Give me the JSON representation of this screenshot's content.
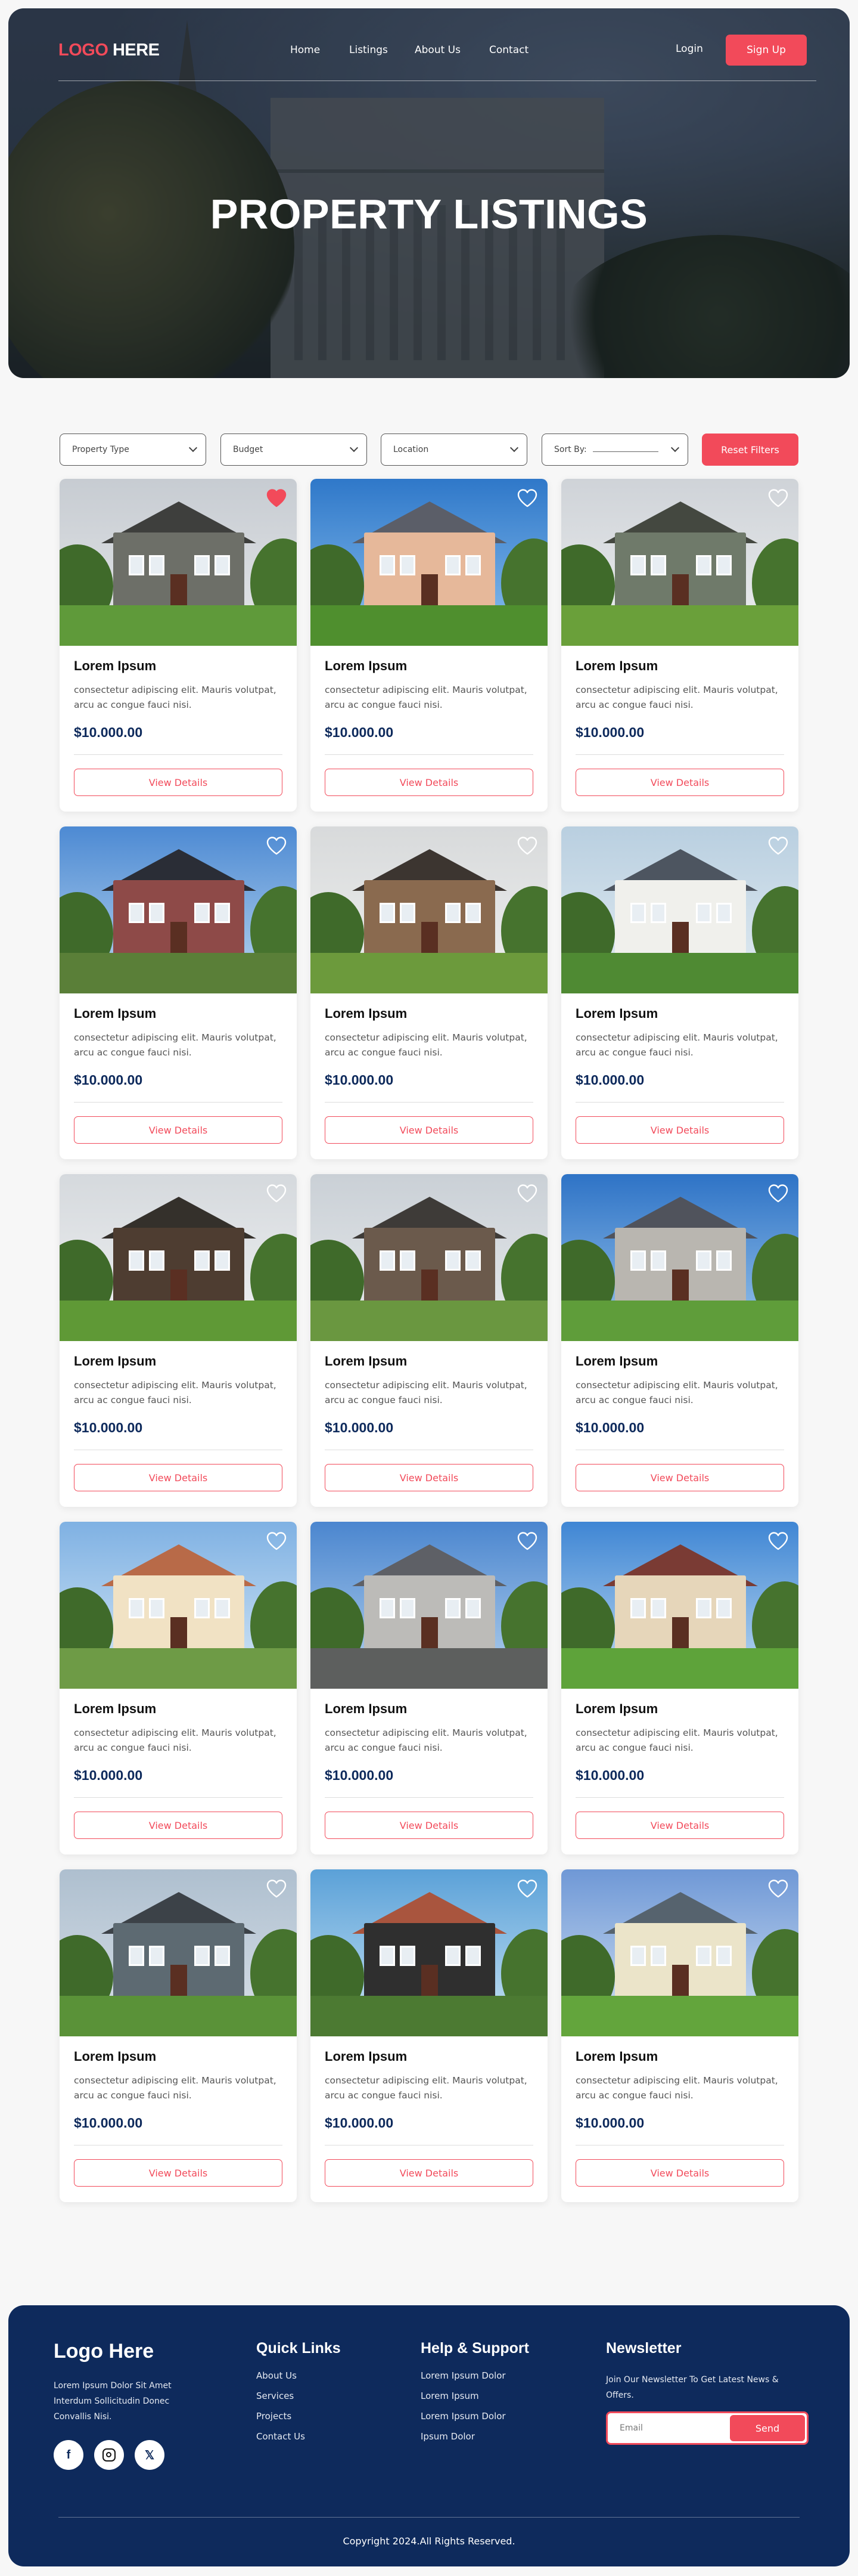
{
  "header": {
    "logo_part1": "LOGO",
    "logo_part2": "HERE",
    "nav": [
      {
        "label": "Home"
      },
      {
        "label": "Listings"
      },
      {
        "label": "About Us"
      },
      {
        "label": "Contact"
      }
    ],
    "login": "Login",
    "signup": "Sign Up"
  },
  "hero": {
    "title": "PROPERTY LISTINGS"
  },
  "filters": {
    "property_type": "Property Type",
    "budget": "Budget",
    "location": "Location",
    "sort_by": "Sort By:",
    "reset": "Reset Filters"
  },
  "listings": [
    {
      "title": "Lorem Ipsum",
      "desc": "consectetur adipiscing elit. Mauris volutpat, arcu ac congue fauci nisi.",
      "price": "$10.000.00",
      "cta": "View Details",
      "favorited": true
    },
    {
      "title": "Lorem Ipsum",
      "desc": "consectetur adipiscing elit. Mauris volutpat, arcu ac congue fauci nisi.",
      "price": "$10.000.00",
      "cta": "View Details",
      "favorited": false
    },
    {
      "title": "Lorem Ipsum",
      "desc": "consectetur adipiscing elit. Mauris volutpat, arcu ac congue fauci nisi.",
      "price": "$10.000.00",
      "cta": "View Details",
      "favorited": false
    },
    {
      "title": "Lorem Ipsum",
      "desc": "consectetur adipiscing elit. Mauris volutpat, arcu ac congue fauci nisi.",
      "price": "$10.000.00",
      "cta": "View Details",
      "favorited": false
    },
    {
      "title": "Lorem Ipsum",
      "desc": "consectetur adipiscing elit. Mauris volutpat, arcu ac congue fauci nisi.",
      "price": "$10.000.00",
      "cta": "View Details",
      "favorited": false
    },
    {
      "title": "Lorem Ipsum",
      "desc": "consectetur adipiscing elit. Mauris volutpat, arcu ac congue fauci nisi.",
      "price": "$10.000.00",
      "cta": "View Details",
      "favorited": false
    },
    {
      "title": "Lorem Ipsum",
      "desc": "consectetur adipiscing elit. Mauris volutpat, arcu ac congue fauci nisi.",
      "price": "$10.000.00",
      "cta": "View Details",
      "favorited": false
    },
    {
      "title": "Lorem Ipsum",
      "desc": "consectetur adipiscing elit. Mauris volutpat, arcu ac congue fauci nisi.",
      "price": "$10.000.00",
      "cta": "View Details",
      "favorited": false
    },
    {
      "title": "Lorem Ipsum",
      "desc": "consectetur adipiscing elit. Mauris volutpat, arcu ac congue fauci nisi.",
      "price": "$10.000.00",
      "cta": "View Details",
      "favorited": false
    },
    {
      "title": "Lorem Ipsum",
      "desc": "consectetur adipiscing elit. Mauris volutpat, arcu ac congue fauci nisi.",
      "price": "$10.000.00",
      "cta": "View Details",
      "favorited": false
    },
    {
      "title": "Lorem Ipsum",
      "desc": "consectetur adipiscing elit. Mauris volutpat, arcu ac congue fauci nisi.",
      "price": "$10.000.00",
      "cta": "View Details",
      "favorited": false
    },
    {
      "title": "Lorem Ipsum",
      "desc": "consectetur adipiscing elit. Mauris volutpat, arcu ac congue fauci nisi.",
      "price": "$10.000.00",
      "cta": "View Details",
      "favorited": false
    },
    {
      "title": "Lorem Ipsum",
      "desc": "consectetur adipiscing elit. Mauris volutpat, arcu ac congue fauci nisi.",
      "price": "$10.000.00",
      "cta": "View Details",
      "favorited": false
    },
    {
      "title": "Lorem Ipsum",
      "desc": "consectetur adipiscing elit. Mauris volutpat, arcu ac congue fauci nisi.",
      "price": "$10.000.00",
      "cta": "View Details",
      "favorited": false
    },
    {
      "title": "Lorem Ipsum",
      "desc": "consectetur adipiscing elit. Mauris volutpat, arcu ac congue fauci nisi.",
      "price": "$10.000.00",
      "cta": "View Details",
      "favorited": false
    }
  ],
  "footer": {
    "logo": "Logo Here",
    "about": "Lorem Ipsum Dolor Sit Amet Interdum Sollicitudin Donec Convallis Nisi.",
    "socials": [
      {
        "icon": "facebook-icon",
        "glyph": "f"
      },
      {
        "icon": "instagram-icon"
      },
      {
        "icon": "x-icon",
        "glyph": "𝕏"
      }
    ],
    "quick_links_title": "Quick Links",
    "quick_links": [
      "About Us",
      "Services",
      "Projects",
      "Contact Us"
    ],
    "help_title": "Help & Support",
    "help_links": [
      "Lorem Ipsum Dolor",
      "Lorem Ipsum",
      "Lorem Ipsum Dolor",
      "Ipsum Dolor"
    ],
    "newsletter_title": "Newsletter",
    "newsletter_text": "Join Our Newsletter To Get Latest News & Offers.",
    "email_placeholder": "Email",
    "send": "Send",
    "copyright": "Copyright 2024.All Rights Reserved."
  },
  "colors": {
    "accent": "#f24a5a",
    "navy": "#0e2a5c"
  }
}
